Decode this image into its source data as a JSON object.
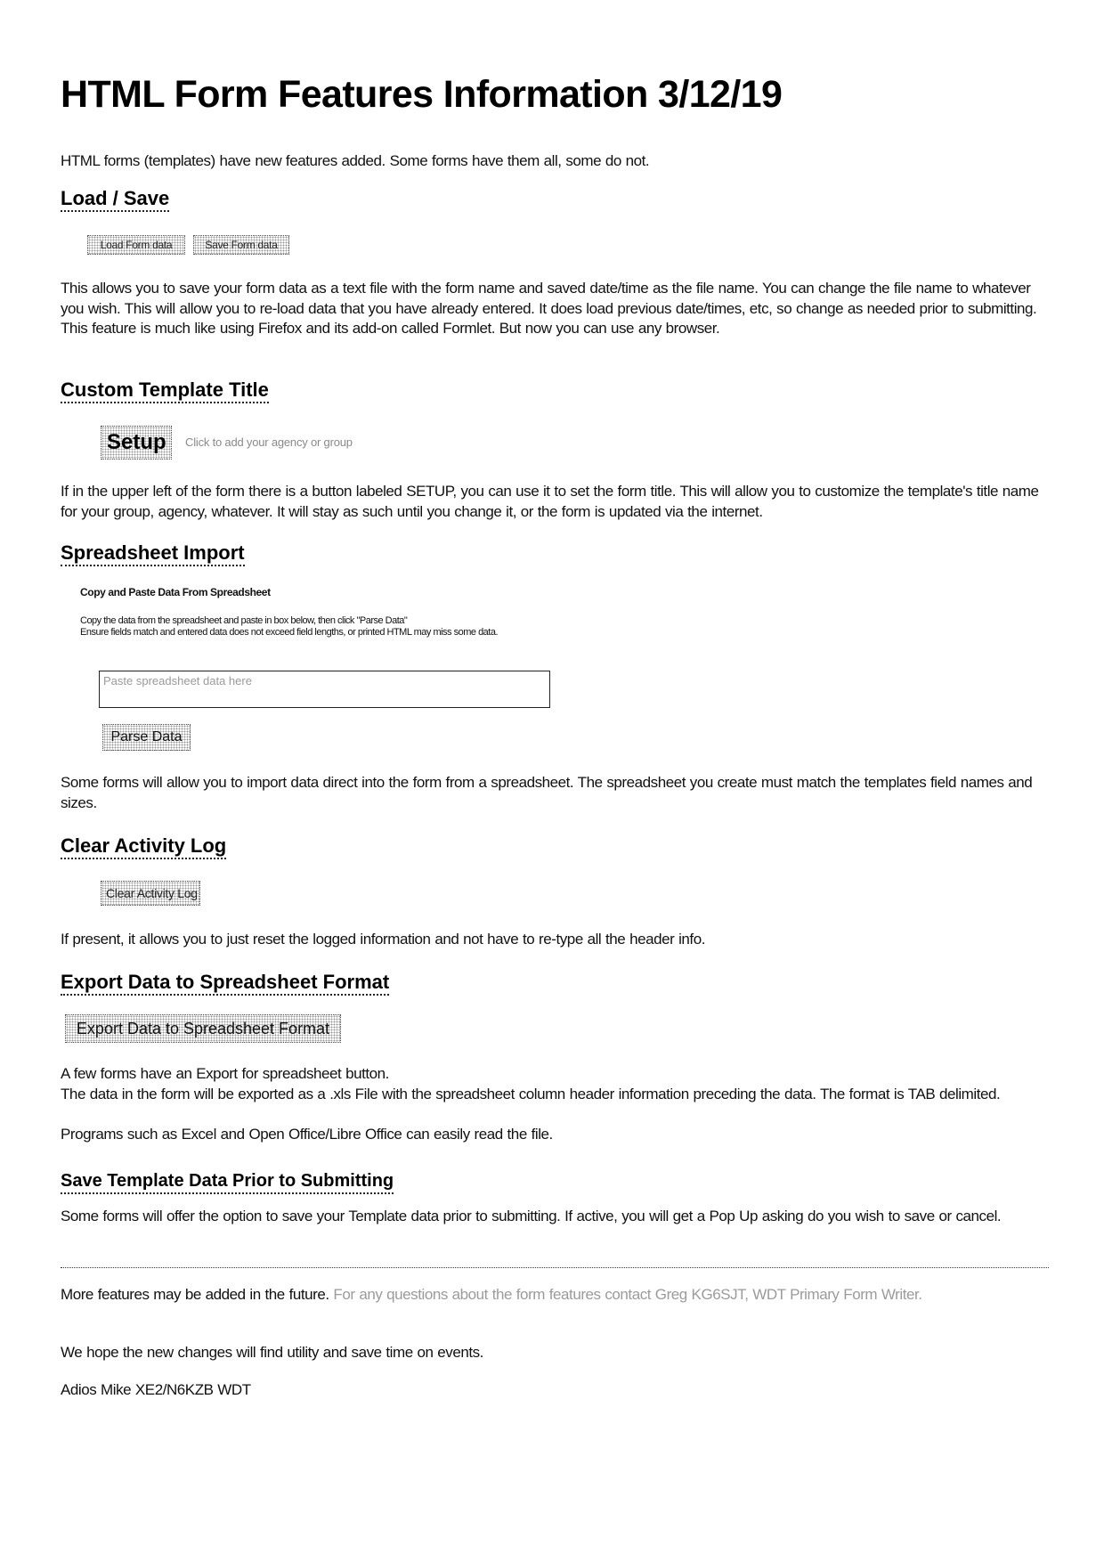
{
  "document": {
    "title": "HTML Form Features Information 3/12/19",
    "intro": "HTML forms (templates) have new features added. Some forms have them all, some do not."
  },
  "sections": {
    "load_save": {
      "heading": "Load / Save",
      "buttons": [
        "Load Form data",
        "Save Form data"
      ],
      "body": "This allows you to save your form data as a text file with the form name and saved date/time as the file name. You can change the file name to whatever you wish. This will allow you to re-load data that you have already entered. It does load previous date/times, etc, so change as needed prior to submitting. This feature is much like using Firefox and its add-on called Formlet. But now you can use any browser."
    },
    "custom_title": {
      "heading": "Custom Template Title",
      "button": "Setup",
      "hint": "Click to add your agency or group",
      "body": "If in the upper left of the form there is a button labeled SETUP, you can use it to set the form title. This will allow you to customize the template's title name for your group, agency, whatever. It will stay as such until you change it, or the form is updated via the internet."
    },
    "spreadsheet_import": {
      "heading": "Spreadsheet Import",
      "subheading": "Copy and Paste Data From Spreadsheet",
      "instructions": [
        "Copy the data from the spreadsheet and paste in box below, then click \"Parse Data\"",
        "Ensure fields match and entered data does not exceed field lengths, or printed HTML may miss some data."
      ],
      "textarea_placeholder": "Paste spreadsheet data here",
      "textarea_value": "",
      "button": "Parse Data",
      "body": "Some forms will allow you to import data direct into the form from a spreadsheet. The spreadsheet you create must match the templates field names and sizes."
    },
    "clear_log": {
      "heading": "Clear Activity Log",
      "button": "Clear Activity Log",
      "body": "If present, it allows you to just reset the logged information and not have to re-type all the header info."
    },
    "export": {
      "heading": "Export Data to Spreadsheet Format",
      "button": "Export Data to Spreadsheet Format",
      "body_lines": [
        "A few forms have an Export for spreadsheet button.",
        "The data in the form will be exported as a .xls File with the spreadsheet column header information preceding the data. The format is TAB delimited.",
        "Programs such as Excel and Open Office/Libre Office can easily read the file."
      ]
    },
    "save_prior": {
      "heading": "Save Template Data Prior to Submitting",
      "body": "Some forms will offer the option to save your Template data prior to submitting. If active, you will get a Pop Up asking do you wish to save or cancel."
    }
  },
  "footer": {
    "more_features": "More features may be added in the future.",
    "contact": " For any questions about the form features contact Greg KG6SJT, WDT Primary Form Writer.",
    "hope": "We hope the new changes will find utility and save time on events.",
    "signature": "Adios Mike XE2/N6KZB WDT"
  }
}
